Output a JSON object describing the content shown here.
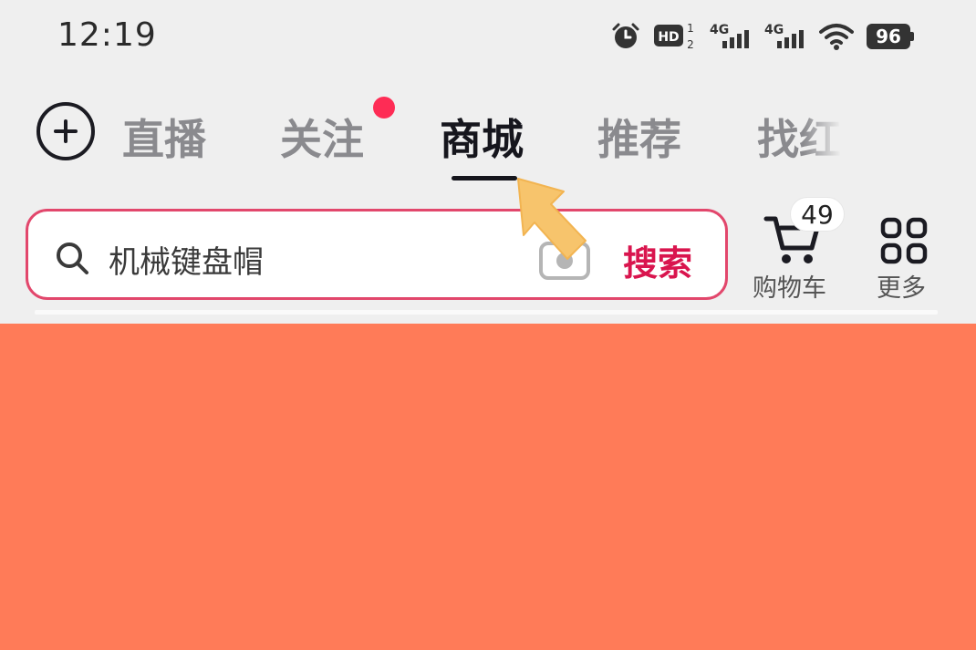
{
  "status_bar": {
    "time": "12:19",
    "icons": [
      "alarm-icon",
      "hd-icon",
      "signal-4g-icon",
      "signal-4g-icon",
      "wifi-icon",
      "battery-icon"
    ],
    "hd_label": "HD",
    "hd_sim_top": "1",
    "hd_sim_bottom": "2",
    "network_label_1": "4G",
    "network_label_2": "4G",
    "battery_level": "96"
  },
  "tabs": {
    "items": [
      {
        "label": "直播",
        "active": false
      },
      {
        "label": "关注",
        "active": false,
        "notification_dot": true
      },
      {
        "label": "商城",
        "active": true
      },
      {
        "label": "推荐",
        "active": false
      },
      {
        "label": "找红",
        "active": false
      }
    ]
  },
  "search": {
    "value": "机械键盘帽",
    "button_label": "搜索"
  },
  "actions": {
    "cart": {
      "label": "购物车",
      "badge": "49"
    },
    "more": {
      "label": "更多"
    }
  },
  "colors": {
    "page_background": "#efefef",
    "accent": "#fe2c55",
    "search_border": "#e2476c",
    "search_button": "#d9154e",
    "content_background": "#ff7b58",
    "pointer": "#f7c46c",
    "active_tab": "#16161d",
    "inactive_tab": "#8a8a8e"
  }
}
